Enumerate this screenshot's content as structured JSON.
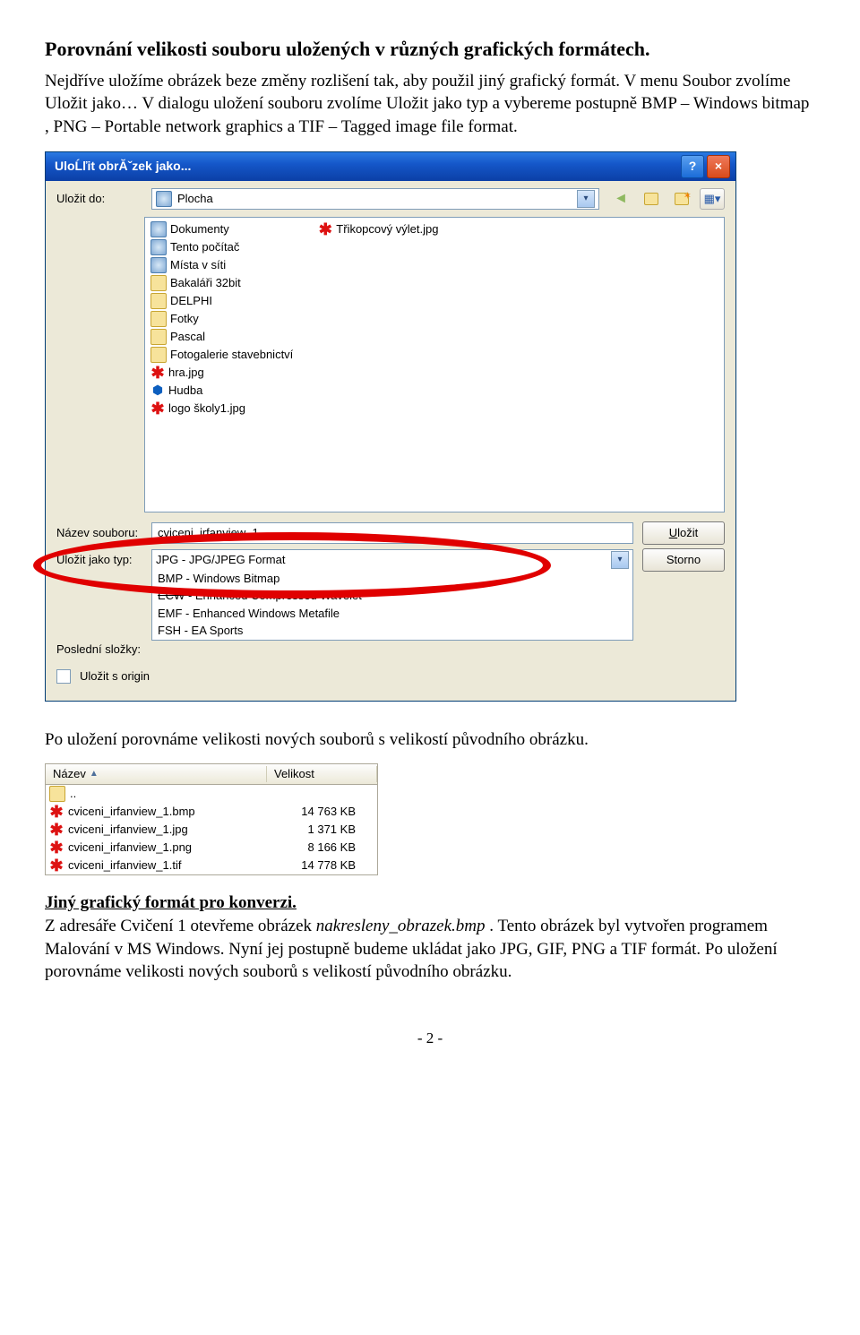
{
  "heading": "Porovnání velikosti souboru uložených v různých grafických formátech.",
  "intro": "Nejdříve uložíme obrázek beze změny rozlišení tak, aby použil jiný grafický formát. V menu Soubor zvolíme Uložit jako… V dialogu uložení souboru zvolíme Uložit jako typ a vybereme postupně BMP – Windows bitmap , PNG – Portable network graphics a TIF – Tagged image file format.",
  "dialog": {
    "title": "UloĹľit obrĂˇzek jako...",
    "save_in_label": "Uložit do:",
    "save_in_value": "Plocha",
    "file_items_col1": [
      {
        "icon": "sys",
        "label": "Dokumenty"
      },
      {
        "icon": "sys",
        "label": "Tento počítač"
      },
      {
        "icon": "sys",
        "label": "Místa v síti"
      },
      {
        "icon": "folder",
        "label": "Bakaláři 32bit"
      },
      {
        "icon": "folder",
        "label": "DELPHI"
      },
      {
        "icon": "folder",
        "label": "Fotky"
      },
      {
        "icon": "folder",
        "label": "Pascal"
      },
      {
        "icon": "folder",
        "label": "Fotogalerie stavebnictví"
      },
      {
        "icon": "red",
        "label": "hra.jpg"
      },
      {
        "icon": "web",
        "label": "Hudba"
      },
      {
        "icon": "red",
        "label": "logo školy1.jpg"
      }
    ],
    "file_items_col2": [
      {
        "icon": "red",
        "label": "Třikopcový výlet.jpg"
      }
    ],
    "name_label": "Název souboru:",
    "name_value": "cviceni_irfanview_1",
    "type_label": "Uložit jako typ:",
    "type_value": "JPG - JPG/JPEG Format",
    "dropdown_items": [
      "BMP - Windows Bitmap",
      "ECW - Enhanced Compressed Wavelet",
      "EMF - Enhanced Windows Metafile",
      "FSH - EA Sports"
    ],
    "recent_label": "Poslední složky:",
    "orig_label": "Uložit s origin",
    "btn_save": "Uložit",
    "btn_cancel": "Storno"
  },
  "after_dialog": "Po uložení porovnáme velikosti nových souborů s velikostí původního obrázku.",
  "size_table": {
    "headers": {
      "name": "Název",
      "size": "Velikost"
    },
    "rows": [
      {
        "name": "cviceni_irfanview_1.bmp",
        "size": "14 763 KB"
      },
      {
        "name": "cviceni_irfanview_1.jpg",
        "size": "1 371 KB"
      },
      {
        "name": "cviceni_irfanview_1.png",
        "size": "8 166 KB"
      },
      {
        "name": "cviceni_irfanview_1.tif",
        "size": "14 778 KB"
      }
    ]
  },
  "section2_title": "Jiný grafický formát pro konverzi.",
  "section2_pre": "Z adresáře Cvičení 1 otevřeme obrázek ",
  "section2_em": "nakresleny_obrazek.bmp",
  "section2_post": " . Tento obrázek byl vytvořen programem Malování v MS Windows. Nyní jej postupně budeme ukládat jako JPG, GIF, PNG a TIF formát. Po uložení porovnáme velikosti nových souborů s velikostí původního obrázku.",
  "page_num": "- 2 -"
}
